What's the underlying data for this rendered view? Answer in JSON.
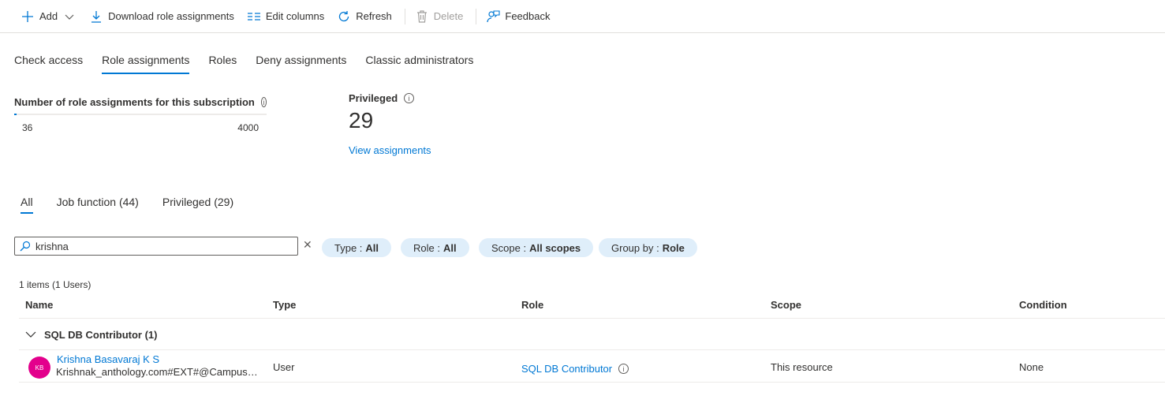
{
  "toolbar": {
    "add": "Add",
    "download": "Download role assignments",
    "edit_columns": "Edit columns",
    "refresh": "Refresh",
    "delete": "Delete",
    "feedback": "Feedback"
  },
  "tabs": [
    "Check access",
    "Role assignments",
    "Roles",
    "Deny assignments",
    "Classic administrators"
  ],
  "active_tab": "Role assignments",
  "stats": {
    "count_title": "Number of role assignments for this subscription",
    "current": "36",
    "max": "4000",
    "fill_fraction": 0.009,
    "privileged_title": "Privileged",
    "privileged_count": "29",
    "view_assignments": "View assignments"
  },
  "subtabs": [
    "All",
    "Job function (44)",
    "Privileged (29)"
  ],
  "search": {
    "value": "krishna"
  },
  "filters": {
    "type_label": "Type :",
    "type_value": "All",
    "role_label": "Role :",
    "role_value": "All",
    "scope_label": "Scope :",
    "scope_value": "All scopes",
    "groupby_label": "Group by :",
    "groupby_value": "Role"
  },
  "table": {
    "items_count": "1 items (1 Users)",
    "headers": {
      "name": "Name",
      "type": "Type",
      "role": "Role",
      "scope": "Scope",
      "condition": "Condition"
    },
    "group_label": "SQL DB Contributor (1)",
    "row": {
      "initials": "KB",
      "name": "Krishna Basavaraj K S",
      "email": "Krishnak_anthology.com#EXT#@CampusNexus.onmicrosoft.com",
      "type": "User",
      "role": "SQL DB Contributor",
      "scope": "This resource",
      "condition": "None"
    }
  },
  "colors": {
    "accent": "#0078d4",
    "pill_bg": "#dfeefa",
    "avatar": "#e3008c"
  }
}
